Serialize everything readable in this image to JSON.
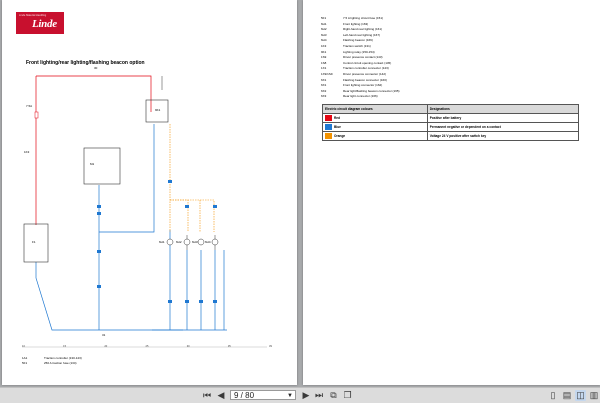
{
  "brand": {
    "tagline": "Linde Material Handling",
    "wordmark": "Linde"
  },
  "diagram": {
    "title": "Front lighting/rear lighting/flashing beacon option",
    "fuse_label": "F1",
    "line_labels": {
      "top": "30",
      "mid": "31"
    },
    "nodes": [
      "1K3",
      "9K1",
      "6H1",
      "6H2",
      "6H3",
      "6H4",
      "7.5A",
      "M1"
    ],
    "legend": [
      {
        "code": "1A1",
        "text": "Traction controller (130-143)"
      },
      {
        "code": "5F1",
        "text": "250 A traction fuse (134)"
      }
    ],
    "tick_numbers": [
      "10",
      "11",
      "12",
      "13",
      "14",
      "15",
      "16",
      "17",
      "18",
      "19",
      "20",
      "21",
      "22",
      "23",
      "24",
      "25",
      "26",
      "27",
      "28",
      "29",
      "30",
      "31",
      "32",
      "33",
      "34",
      "35",
      "36",
      "37",
      "38",
      "39"
    ]
  },
  "components": [
    {
      "code": "5F1",
      "text": "7.5 A lighting circuit fuse (151)"
    },
    {
      "code": "6H1",
      "text": "Front lighting (163)"
    },
    {
      "code": "6H2",
      "text": "Right-hand rear lighting (161)"
    },
    {
      "code": "6H3",
      "text": "Left-hand rear lighting (167)"
    },
    {
      "code": "6H4",
      "text": "Flashing beacon (169)"
    },
    {
      "code": "1K3",
      "text": "Traction switch (131)"
    },
    {
      "code": "9K1",
      "text": "Lighting relay (150-154)"
    },
    {
      "code": "1S9",
      "text": "Driver presence contact (143)"
    },
    {
      "code": "1S8",
      "text": "Control circuit opening contact (145)"
    },
    {
      "code": "1X1",
      "text": "Traction controller connector (143)"
    },
    {
      "code": "1X9/1S9",
      "text": "Driver presence connector (142)"
    },
    {
      "code": "6X1",
      "text": "Flashing beacon connector (160)"
    },
    {
      "code": "6X1",
      "text": "Front lighting connector (162)"
    },
    {
      "code": "6X2",
      "text": "Rear light/flashing beacon connector (165)"
    },
    {
      "code": "6X3",
      "text": "Rear light connector (166)"
    }
  ],
  "color_table": {
    "headers": [
      "Electric circuit diagram colours",
      "Designations"
    ],
    "rows": [
      {
        "name": "Red",
        "color": "#e30613",
        "designation": "Positive after battery"
      },
      {
        "name": "Blue",
        "color": "#1f78d1",
        "designation": "Permanent negative or dependent on a contact"
      },
      {
        "name": "Orange",
        "color": "#f39200",
        "designation": "Voltage 24 V positive after switch key"
      }
    ]
  },
  "toolbar": {
    "page_value": "9 / 80",
    "icons": [
      "first-page-icon",
      "previous-page-icon",
      "next-page-icon",
      "last-page-icon",
      "copy-icon",
      "copy-all-icon",
      "single-page-icon",
      "continuous-page-icon",
      "two-page-icon",
      "two-page-continuous-icon"
    ]
  }
}
